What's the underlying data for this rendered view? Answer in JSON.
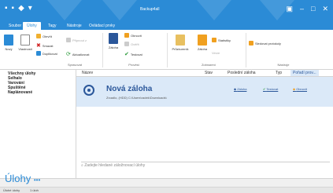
{
  "window": {
    "title": "Backup4all",
    "quick_access": [
      "▪",
      "▪",
      "◆",
      "▾"
    ],
    "controls": [
      "▣",
      "–",
      "□",
      "✕"
    ]
  },
  "tabs": [
    {
      "label": "Soubor"
    },
    {
      "label": "Úlohy"
    },
    {
      "label": "Tagy"
    },
    {
      "label": "Nástroje"
    },
    {
      "label": "Ovládací prvky"
    }
  ],
  "ribbon": {
    "new_label": "Nový",
    "properties_label": "Vlastnosti",
    "open_label": "Otevřít",
    "delete_label": "Smazat",
    "duplicate_label": "Duplikovat",
    "pin_label": "Připnout z",
    "refresh_label": "Aktualizovat",
    "backup_label": "Záloha",
    "restore_label": "Obnovit",
    "verify_label": "Ověřit",
    "test_label": "Testovat",
    "explore_label": "Průzkumník",
    "backup2_label": "Záloha",
    "versions_label": "Verze",
    "stats_label": "Statistiky",
    "logs_label": "Sledovat protokoly",
    "groups": [
      "Spravovat",
      "Provést",
      "Zobrazení",
      "Nástroje"
    ]
  },
  "nav": {
    "items": [
      "Všechny úlohy",
      "Selhalo",
      "Varování",
      "Spuštěné",
      "Naplánované"
    ]
  },
  "columns": {
    "name": "Název",
    "status": "Stav",
    "last_backup": "Poslední záloha",
    "type": "Typ",
    "order": "Pořadí prov..."
  },
  "job": {
    "title": "Nová záloha",
    "path": "Zrcadlo, (HDD) C:\\Users\\radek\\Downloads\\",
    "links": [
      "Záloha",
      "Testovat",
      "Obnovit"
    ]
  },
  "search": {
    "placeholder": "Zadejte hledané záložnovací úlohy"
  },
  "bottom": {
    "label": "Úlohy",
    "more": "•••"
  },
  "status": {
    "left": "Úlohé úlohy",
    "right": "1 úloh"
  }
}
